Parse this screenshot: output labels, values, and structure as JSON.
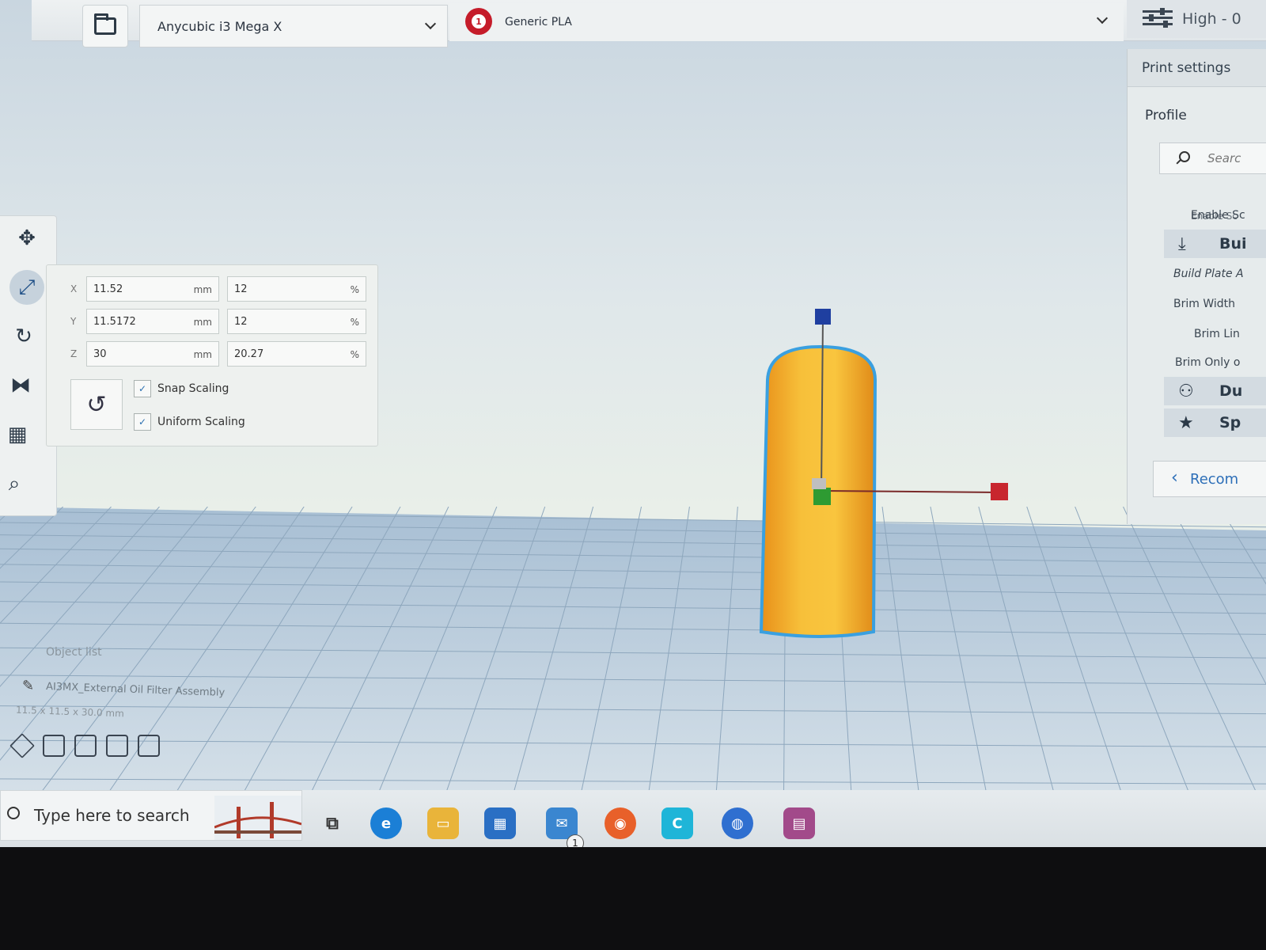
{
  "topbar": {
    "printer": "Anycubic i3 Mega X",
    "material": "Generic PLA",
    "quality": "High - 0"
  },
  "scale_panel": {
    "x": {
      "label": "X",
      "mm": "11.52",
      "mm_unit": "mm",
      "pct": "12",
      "pct_unit": "%"
    },
    "y": {
      "label": "Y",
      "mm": "11.5172",
      "mm_unit": "mm",
      "pct": "12",
      "pct_unit": "%"
    },
    "z": {
      "label": "Z",
      "mm": "30",
      "mm_unit": "mm",
      "pct": "20.27",
      "pct_unit": "%"
    },
    "snap_scaling": "Snap Scaling",
    "uniform_scaling": "Uniform Scaling"
  },
  "print_settings": {
    "header": "Print settings",
    "profile": "Profile",
    "search_placeholder": "Searc",
    "items": {
      "enable_cut": "Enable Sc",
      "enable_s": "Enable Sc",
      "build_plate_cat": "Bui",
      "build_plate_adhesion": "Build Plate A",
      "brim_width": "Brim Width",
      "brim_line": "Brim Lin",
      "brim_only": "Brim Only o",
      "dual_cat": "Du",
      "special_cat": "Sp"
    },
    "recommended": "Recom"
  },
  "object_list": {
    "title": "Object list",
    "object_name": "AI3MX_External Oil Filter Assembly",
    "dimensions": "11.5 x 11.5 x 30.0 mm"
  },
  "taskbar": {
    "search": "Type here to search",
    "mail_badge": "1"
  },
  "colors": {
    "model": "#f2b328",
    "model_outline": "#3aa0e0",
    "gizmo_x": "#c8262e",
    "gizmo_y": "#2e9b32",
    "gizmo_z": "#1f3fa0",
    "accent": "#2d6fb8"
  }
}
